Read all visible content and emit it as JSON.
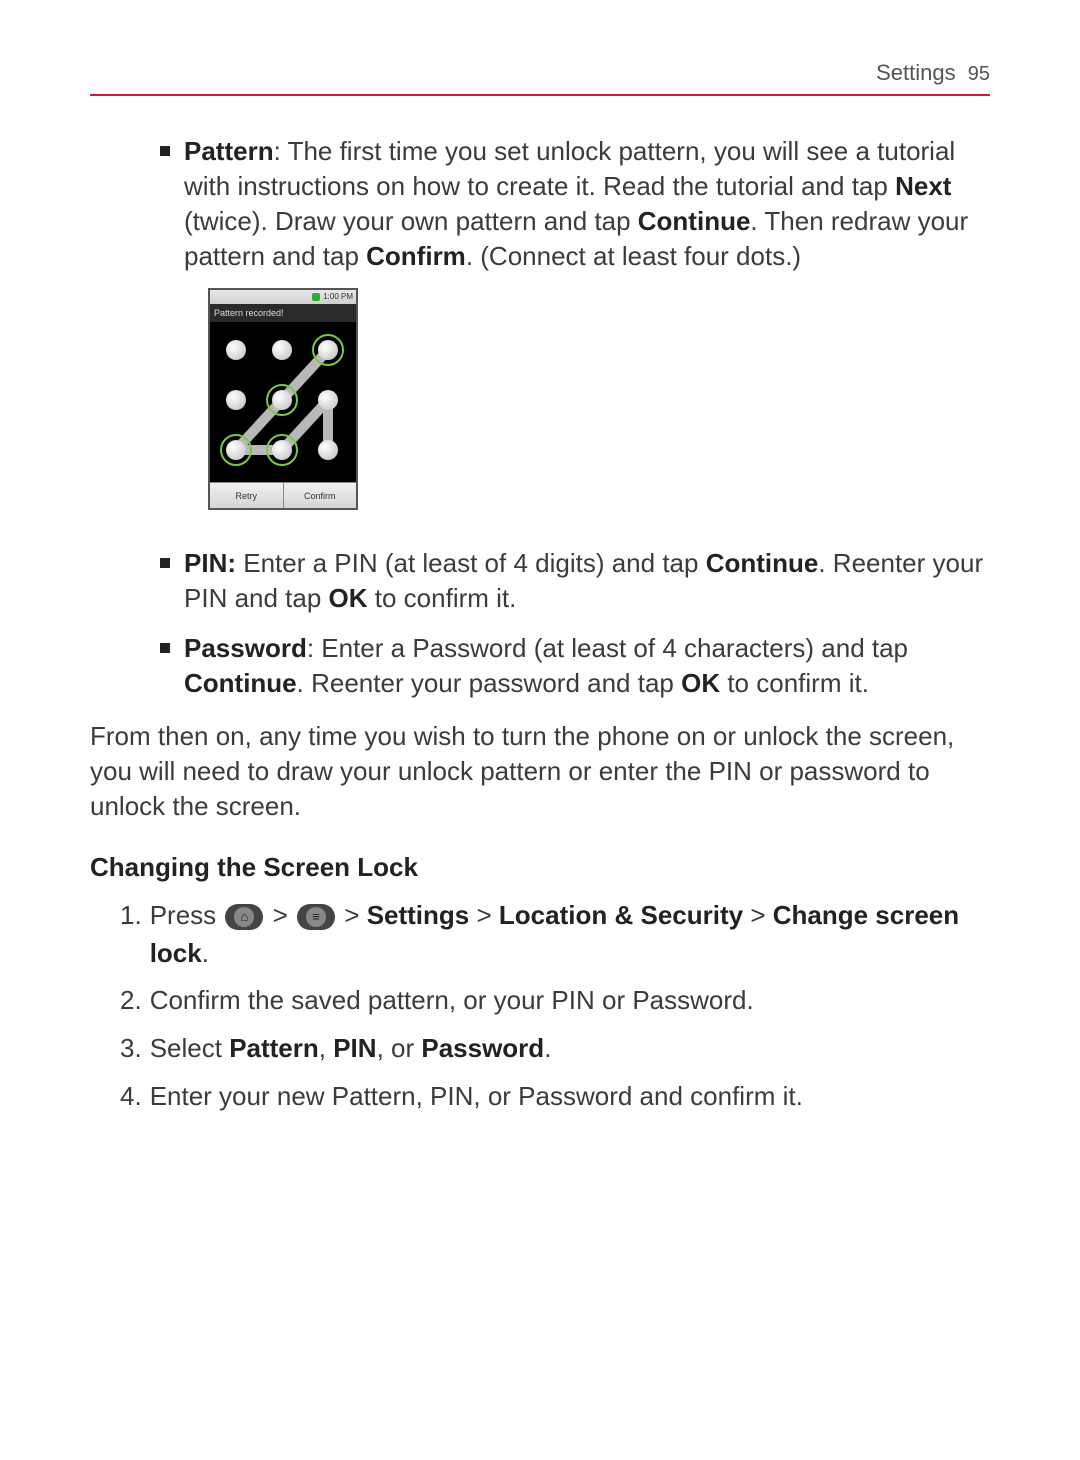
{
  "header": {
    "section": "Settings",
    "page": "95"
  },
  "bullets": {
    "pattern": {
      "label": "Pattern",
      "sep": ": ",
      "p1": "The first time you set unlock pattern, you will see a tutorial with instructions on how to create it. Read the tutorial and tap ",
      "b1": "Next",
      "p2": " (twice). Draw your own pattern and tap ",
      "b2": "Continue",
      "p3": ". Then redraw your pattern and tap ",
      "b3": "Confirm",
      "p4": ". (Connect at least four dots.)"
    },
    "pin": {
      "label": "PIN:",
      "p1": " Enter a PIN (at least of 4 digits) and tap ",
      "b1": "Continue",
      "p2": ". Reenter your PIN and tap ",
      "b2": "OK",
      "p3": " to confirm it."
    },
    "password": {
      "label": "Password",
      "sep": ": ",
      "p1": "Enter a Password (at least of 4 characters) and tap ",
      "b1": "Continue",
      "p2": ". Reenter your password and tap ",
      "b2": "OK",
      "p3": " to confirm it."
    }
  },
  "afterPara": "From then on, any time you wish to turn the phone on or unlock the screen, you will need to draw your unlock pattern or enter the PIN or password to unlock the screen.",
  "subhead": "Changing the Screen Lock",
  "steps": {
    "s1": {
      "num": "1.",
      "a": "Press ",
      "gt1": " > ",
      "gt2": " > ",
      "b1": "Settings",
      "gt3": " > ",
      "b2": "Location & Security",
      "gt4": " > ",
      "b3": "Change screen lock",
      "end": "."
    },
    "s2": {
      "num": "2.",
      "text": "Confirm the saved pattern, or your PIN or Password."
    },
    "s3": {
      "num": "3.",
      "a": "Select ",
      "b1": "Pattern",
      "c": ", ",
      "b2": "PIN",
      "d": ", or ",
      "b3": "Password",
      "end": "."
    },
    "s4": {
      "num": "4.",
      "text": "Enter your new Pattern, PIN, or Password and confirm it."
    }
  },
  "phone": {
    "time": "1:00 PM",
    "title": "Pattern recorded!",
    "btnRetry": "Retry",
    "btnConfirm": "Confirm"
  }
}
